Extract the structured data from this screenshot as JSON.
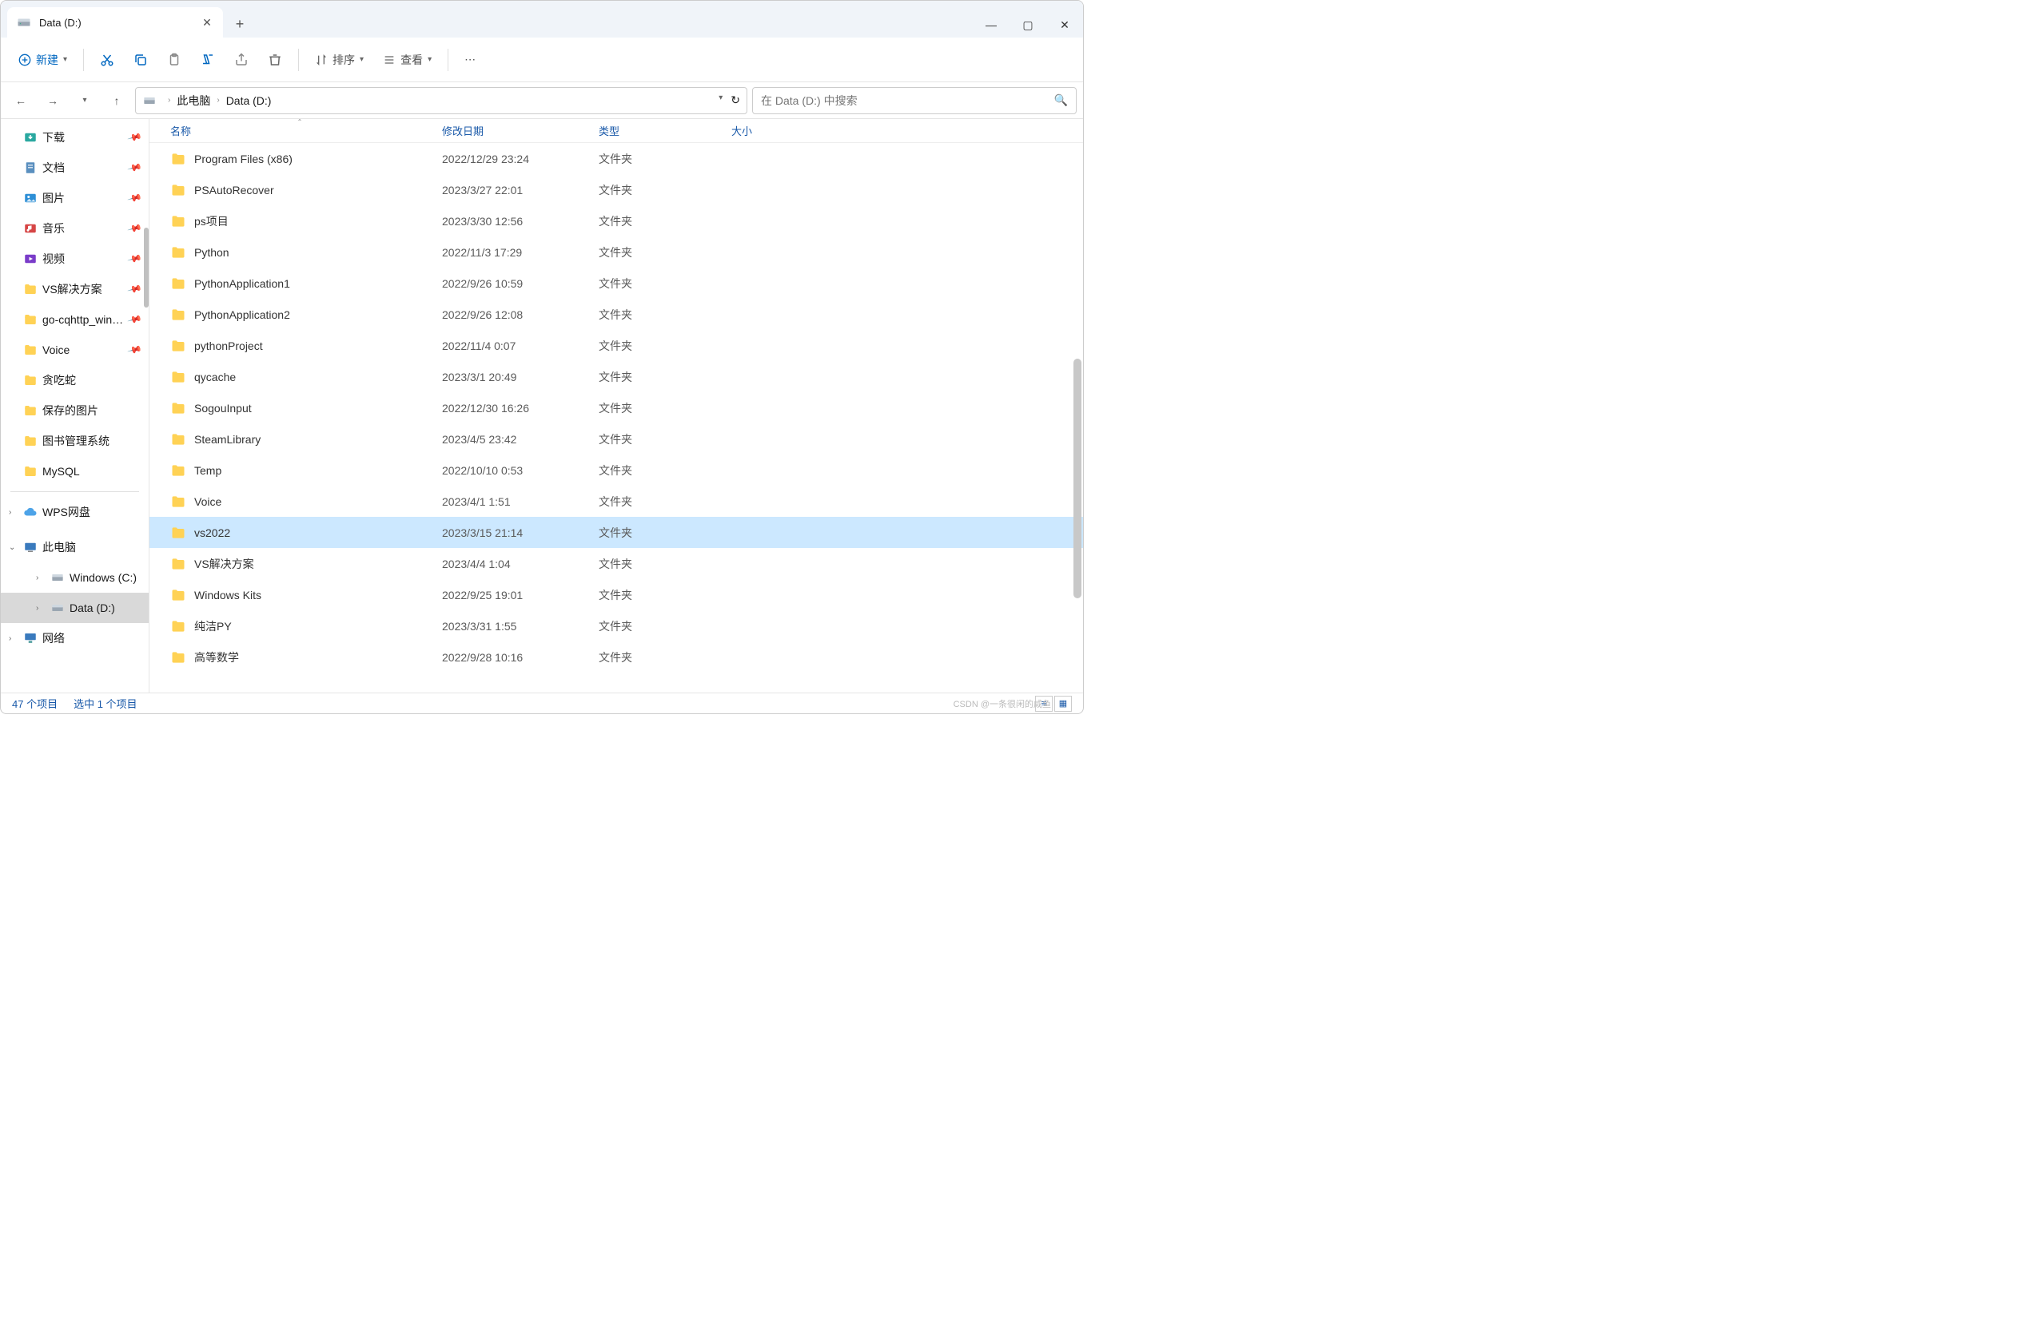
{
  "window": {
    "tab_title": "Data (D:)",
    "minimize": "—",
    "maximize": "▢",
    "close": "✕"
  },
  "toolbar": {
    "new": "新建",
    "sort": "排序",
    "view": "查看"
  },
  "nav": {
    "breadcrumb": [
      "此电脑",
      "Data (D:)"
    ]
  },
  "search": {
    "placeholder": "在 Data (D:) 中搜索"
  },
  "columns": {
    "name": "名称",
    "date": "修改日期",
    "type": "类型",
    "size": "大小"
  },
  "sidebar": {
    "quick": [
      {
        "label": "下载",
        "pinned": true,
        "icon": "downloads",
        "color": "#2aa8a0"
      },
      {
        "label": "文档",
        "pinned": true,
        "icon": "documents",
        "color": "#5a8fbf"
      },
      {
        "label": "图片",
        "pinned": true,
        "icon": "pictures",
        "color": "#2d8fd6"
      },
      {
        "label": "音乐",
        "pinned": true,
        "icon": "music",
        "color": "#d64545"
      },
      {
        "label": "视频",
        "pinned": true,
        "icon": "videos",
        "color": "#7a3cc9"
      },
      {
        "label": "VS解决方案",
        "pinned": true,
        "icon": "folder",
        "color": "#ffd255"
      },
      {
        "label": "go-cqhttp_windows",
        "pinned": true,
        "icon": "folder",
        "color": "#ffd255"
      },
      {
        "label": "Voice",
        "pinned": true,
        "icon": "folder",
        "color": "#ffd255"
      },
      {
        "label": "贪吃蛇",
        "pinned": false,
        "icon": "folder",
        "color": "#ffd255"
      },
      {
        "label": "保存的图片",
        "pinned": false,
        "icon": "folder",
        "color": "#ffd255"
      },
      {
        "label": "图书管理系统",
        "pinned": false,
        "icon": "folder",
        "color": "#ffd255"
      },
      {
        "label": "MySQL",
        "pinned": false,
        "icon": "folder",
        "color": "#ffd255"
      }
    ],
    "wps": "WPS网盘",
    "thispc": "此电脑",
    "drives": [
      {
        "label": "Windows (C:)"
      },
      {
        "label": "Data (D:)",
        "selected": true
      }
    ],
    "network": "网络"
  },
  "files": [
    {
      "name": "Program Files (x86)",
      "date": "2022/12/29 23:24",
      "type": "文件夹"
    },
    {
      "name": "PSAutoRecover",
      "date": "2023/3/27 22:01",
      "type": "文件夹"
    },
    {
      "name": "ps项目",
      "date": "2023/3/30 12:56",
      "type": "文件夹"
    },
    {
      "name": "Python",
      "date": "2022/11/3 17:29",
      "type": "文件夹"
    },
    {
      "name": "PythonApplication1",
      "date": "2022/9/26 10:59",
      "type": "文件夹"
    },
    {
      "name": "PythonApplication2",
      "date": "2022/9/26 12:08",
      "type": "文件夹"
    },
    {
      "name": "pythonProject",
      "date": "2022/11/4 0:07",
      "type": "文件夹"
    },
    {
      "name": "qycache",
      "date": "2023/3/1 20:49",
      "type": "文件夹"
    },
    {
      "name": "SogouInput",
      "date": "2022/12/30 16:26",
      "type": "文件夹"
    },
    {
      "name": "SteamLibrary",
      "date": "2023/4/5 23:42",
      "type": "文件夹"
    },
    {
      "name": "Temp",
      "date": "2022/10/10 0:53",
      "type": "文件夹"
    },
    {
      "name": "Voice",
      "date": "2023/4/1 1:51",
      "type": "文件夹"
    },
    {
      "name": "vs2022",
      "date": "2023/3/15 21:14",
      "type": "文件夹",
      "selected": true
    },
    {
      "name": "VS解决方案",
      "date": "2023/4/4 1:04",
      "type": "文件夹"
    },
    {
      "name": "Windows Kits",
      "date": "2022/9/25 19:01",
      "type": "文件夹"
    },
    {
      "name": "纯洁PY",
      "date": "2023/3/31 1:55",
      "type": "文件夹"
    },
    {
      "name": "高等数学",
      "date": "2022/9/28 10:16",
      "type": "文件夹"
    }
  ],
  "status": {
    "count": "47 个项目",
    "selected": "选中 1 个项目"
  },
  "watermark": "CSDN @一条很闲的咸鱼"
}
